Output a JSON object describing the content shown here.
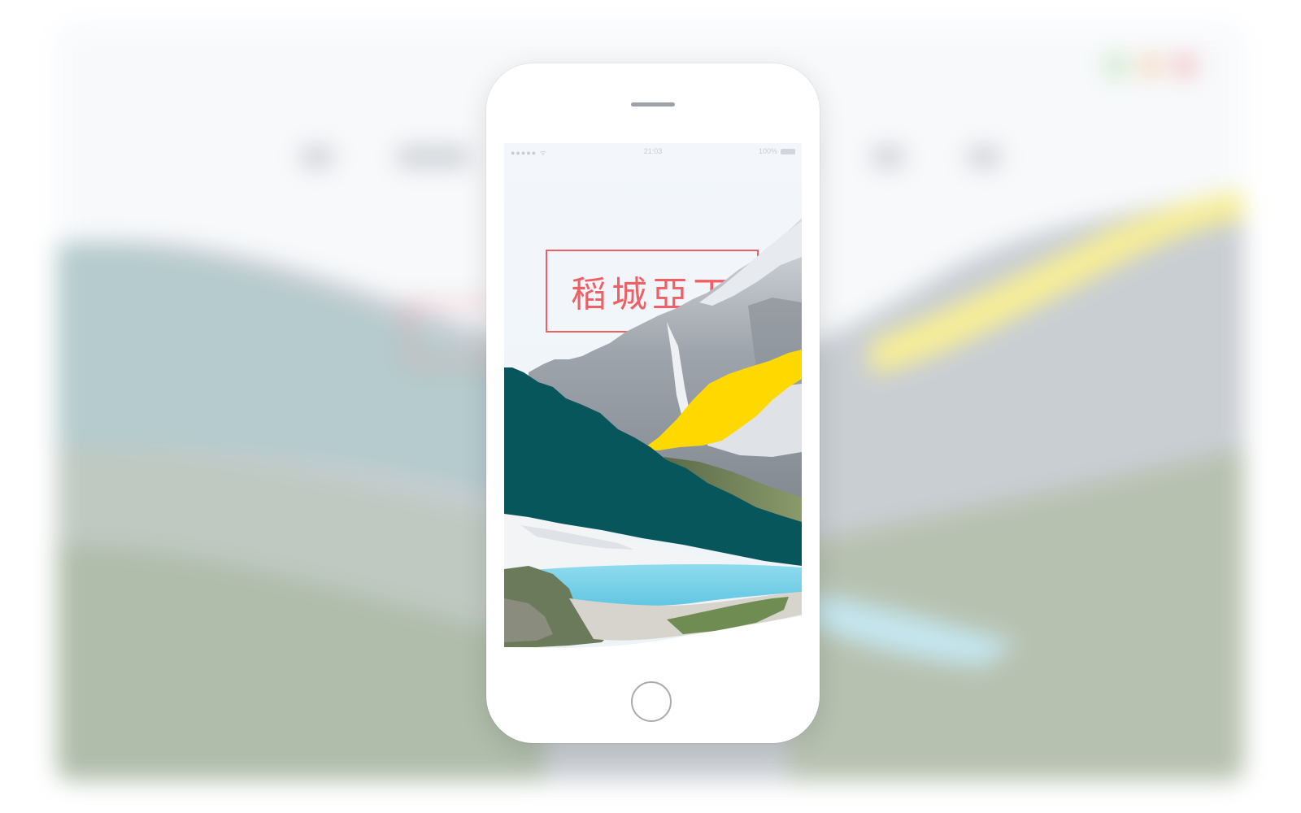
{
  "phone": {
    "status_bar": {
      "signal": "●●●●● ᯤ",
      "time": "21:03",
      "battery": "100%"
    },
    "title": "稻城亞丁"
  },
  "colors": {
    "accent_red": "#ee5f66",
    "teal": "#06565c",
    "yellow": "#ffd800",
    "lake": "#7fd6ec"
  },
  "icons": {
    "home_button": "home-button-icon",
    "speaker": "speaker-icon"
  }
}
